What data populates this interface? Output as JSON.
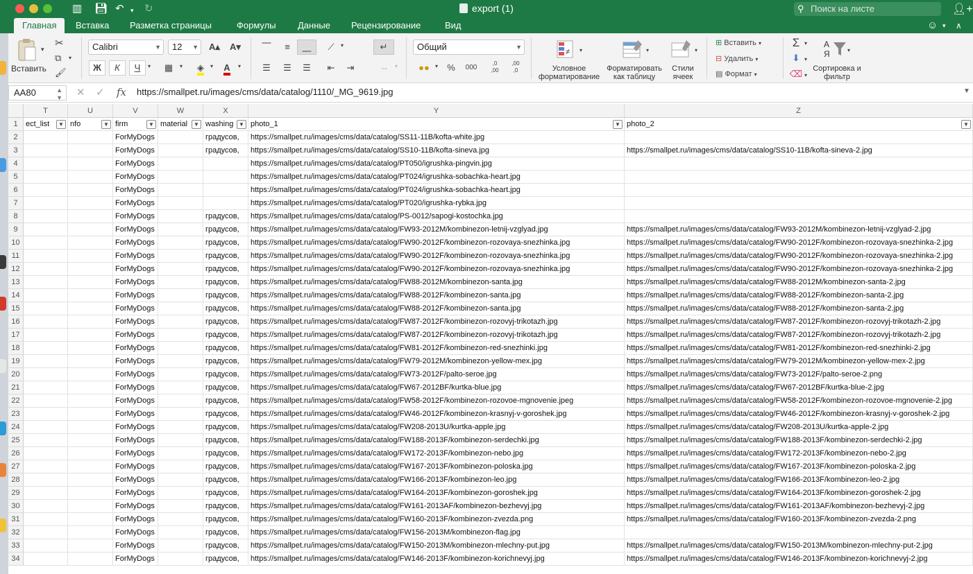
{
  "window": {
    "title": "export (1)",
    "search_placeholder": "Поиск на листе"
  },
  "ribbon_tabs": [
    {
      "label": "Главная",
      "active": true
    },
    {
      "label": "Вставка"
    },
    {
      "label": "Разметка страницы"
    },
    {
      "label": "Формулы"
    },
    {
      "label": "Данные"
    },
    {
      "label": "Рецензирование"
    },
    {
      "label": "Вид"
    }
  ],
  "ribbon": {
    "paste_label": "Вставить",
    "font_name": "Calibri",
    "font_size": "12",
    "bold_label": "Ж",
    "italic_label": "К",
    "underline_label": "Ч",
    "number_format": "Общий",
    "percent_label": "%",
    "thousands_label": "000",
    "conditional_label": "Условное форматирование",
    "format_table_label": "Форматировать как таблицу",
    "styles_label": "Стили ячеек",
    "insert_label": "Вставить",
    "delete_label": "Удалить",
    "format_label": "Формат",
    "sort_label": "Сортировка и фильтр",
    "inc_decimal": ",0\n,00",
    "dec_decimal": ",00\n,0"
  },
  "formula_bar": {
    "name_box": "AA80",
    "fx": "fx",
    "formula": "https://smallpet.ru/images/cms/data/catalog/1110/_MG_9619.jpg"
  },
  "columns": [
    {
      "letter": "T",
      "header": "ect_list"
    },
    {
      "letter": "U",
      "header": "nfo"
    },
    {
      "letter": "V",
      "header": "firm"
    },
    {
      "letter": "W",
      "header": "material"
    },
    {
      "letter": "X",
      "header": "washing"
    },
    {
      "letter": "Y",
      "header": "photo_1"
    },
    {
      "letter": "Z",
      "header": "photo_2"
    }
  ],
  "rows": [
    {
      "n": "2",
      "v": "ForMyDogs",
      "x": "градусов,",
      "y": "https://smallpet.ru/images/cms/data/catalog/SS11-11B/kofta-white.jpg",
      "z": ""
    },
    {
      "n": "3",
      "v": "ForMyDogs",
      "x": "градусов,",
      "y": "https://smallpet.ru/images/cms/data/catalog/SS10-11B/kofta-sineva.jpg",
      "z": "https://smallpet.ru/images/cms/data/catalog/SS10-11B/kofta-sineva-2.jpg"
    },
    {
      "n": "4",
      "v": "ForMyDogs",
      "x": "",
      "y": "https://smallpet.ru/images/cms/data/catalog/PT050/igrushka-pingvin.jpg",
      "z": ""
    },
    {
      "n": "5",
      "v": "ForMyDogs",
      "x": "",
      "y": "https://smallpet.ru/images/cms/data/catalog/PT024/igrushka-sobachka-heart.jpg",
      "z": ""
    },
    {
      "n": "6",
      "v": "ForMyDogs",
      "x": "",
      "y": "https://smallpet.ru/images/cms/data/catalog/PT024/igrushka-sobachka-heart.jpg",
      "z": ""
    },
    {
      "n": "7",
      "v": "ForMyDogs",
      "x": "",
      "y": "https://smallpet.ru/images/cms/data/catalog/PT020/igrushka-rybka.jpg",
      "z": ""
    },
    {
      "n": "8",
      "v": "ForMyDogs",
      "x": "градусов,",
      "y": "https://smallpet.ru/images/cms/data/catalog/PS-0012/sapogi-kostochka.jpg",
      "z": ""
    },
    {
      "n": "9",
      "v": "ForMyDogs",
      "x": "градусов,",
      "y": "https://smallpet.ru/images/cms/data/catalog/FW93-2012M/kombinezon-letnij-vzglyad.jpg",
      "z": "https://smallpet.ru/images/cms/data/catalog/FW93-2012M/kombinezon-letnij-vzglyad-2.jpg"
    },
    {
      "n": "10",
      "v": "ForMyDogs",
      "x": "градусов,",
      "y": "https://smallpet.ru/images/cms/data/catalog/FW90-2012F/kombinezon-rozovaya-snezhinka.jpg",
      "z": "https://smallpet.ru/images/cms/data/catalog/FW90-2012F/kombinezon-rozovaya-snezhinka-2.jpg"
    },
    {
      "n": "11",
      "v": "ForMyDogs",
      "x": "градусов,",
      "y": "https://smallpet.ru/images/cms/data/catalog/FW90-2012F/kombinezon-rozovaya-snezhinka.jpg",
      "z": "https://smallpet.ru/images/cms/data/catalog/FW90-2012F/kombinezon-rozovaya-snezhinka-2.jpg"
    },
    {
      "n": "12",
      "v": "ForMyDogs",
      "x": "градусов,",
      "y": "https://smallpet.ru/images/cms/data/catalog/FW90-2012F/kombinezon-rozovaya-snezhinka.jpg",
      "z": "https://smallpet.ru/images/cms/data/catalog/FW90-2012F/kombinezon-rozovaya-snezhinka-2.jpg"
    },
    {
      "n": "13",
      "v": "ForMyDogs",
      "x": "градусов,",
      "y": "https://smallpet.ru/images/cms/data/catalog/FW88-2012M/kombinezon-santa.jpg",
      "z": "https://smallpet.ru/images/cms/data/catalog/FW88-2012M/kombinezon-santa-2.jpg"
    },
    {
      "n": "14",
      "v": "ForMyDogs",
      "x": "градусов,",
      "y": "https://smallpet.ru/images/cms/data/catalog/FW88-2012F/kombinezon-santa.jpg",
      "z": "https://smallpet.ru/images/cms/data/catalog/FW88-2012F/kombinezon-santa-2.jpg"
    },
    {
      "n": "15",
      "v": "ForMyDogs",
      "x": "градусов,",
      "y": "https://smallpet.ru/images/cms/data/catalog/FW88-2012F/kombinezon-santa.jpg",
      "z": "https://smallpet.ru/images/cms/data/catalog/FW88-2012F/kombinezon-santa-2.jpg"
    },
    {
      "n": "16",
      "v": "ForMyDogs",
      "x": "градусов,",
      "y": "https://smallpet.ru/images/cms/data/catalog/FW87-2012F/kombinezon-rozovyj-trikotazh.jpg",
      "z": "https://smallpet.ru/images/cms/data/catalog/FW87-2012F/kombinezon-rozovyj-trikotazh-2.jpg"
    },
    {
      "n": "17",
      "v": "ForMyDogs",
      "x": "градусов,",
      "y": "https://smallpet.ru/images/cms/data/catalog/FW87-2012F/kombinezon-rozovyj-trikotazh.jpg",
      "z": "https://smallpet.ru/images/cms/data/catalog/FW87-2012F/kombinezon-rozovyj-trikotazh-2.jpg"
    },
    {
      "n": "18",
      "v": "ForMyDogs",
      "x": "градусов,",
      "y": "https://smallpet.ru/images/cms/data/catalog/FW81-2012F/kombinezon-red-snezhinki.jpg",
      "z": "https://smallpet.ru/images/cms/data/catalog/FW81-2012F/kombinezon-red-snezhinki-2.jpg"
    },
    {
      "n": "19",
      "v": "ForMyDogs",
      "x": "градусов,",
      "y": "https://smallpet.ru/images/cms/data/catalog/FW79-2012M/kombinezon-yellow-mex.jpg",
      "z": "https://smallpet.ru/images/cms/data/catalog/FW79-2012M/kombinezon-yellow-mex-2.jpg"
    },
    {
      "n": "20",
      "v": "ForMyDogs",
      "x": "градусов,",
      "y": "https://smallpet.ru/images/cms/data/catalog/FW73-2012F/palto-seroe.jpg",
      "z": "https://smallpet.ru/images/cms/data/catalog/FW73-2012F/palto-seroe-2.png"
    },
    {
      "n": "21",
      "v": "ForMyDogs",
      "x": "градусов,",
      "y": "https://smallpet.ru/images/cms/data/catalog/FW67-2012BF/kurtka-blue.jpg",
      "z": "https://smallpet.ru/images/cms/data/catalog/FW67-2012BF/kurtka-blue-2.jpg"
    },
    {
      "n": "22",
      "v": "ForMyDogs",
      "x": "градусов,",
      "y": "https://smallpet.ru/images/cms/data/catalog/FW58-2012F/kombinezon-rozovoe-mgnovenie.jpeg",
      "z": "https://smallpet.ru/images/cms/data/catalog/FW58-2012F/kombinezon-rozovoe-mgnovenie-2.jpg"
    },
    {
      "n": "23",
      "v": "ForMyDogs",
      "x": "градусов,",
      "y": "https://smallpet.ru/images/cms/data/catalog/FW46-2012F/kombinezon-krasnyj-v-goroshek.jpg",
      "z": "https://smallpet.ru/images/cms/data/catalog/FW46-2012F/kombinezon-krasnyj-v-goroshek-2.jpg"
    },
    {
      "n": "24",
      "v": "ForMyDogs",
      "x": "градусов,",
      "y": "https://smallpet.ru/images/cms/data/catalog/FW208-2013U/kurtka-apple.jpg",
      "z": "https://smallpet.ru/images/cms/data/catalog/FW208-2013U/kurtka-apple-2.jpg"
    },
    {
      "n": "25",
      "v": "ForMyDogs",
      "x": "градусов,",
      "y": "https://smallpet.ru/images/cms/data/catalog/FW188-2013F/kombinezon-serdechki.jpg",
      "z": "https://smallpet.ru/images/cms/data/catalog/FW188-2013F/kombinezon-serdechki-2.jpg"
    },
    {
      "n": "26",
      "v": "ForMyDogs",
      "x": "градусов,",
      "y": "https://smallpet.ru/images/cms/data/catalog/FW172-2013F/kombinezon-nebo.jpg",
      "z": "https://smallpet.ru/images/cms/data/catalog/FW172-2013F/kombinezon-nebo-2.jpg"
    },
    {
      "n": "27",
      "v": "ForMyDogs",
      "x": "градусов,",
      "y": "https://smallpet.ru/images/cms/data/catalog/FW167-2013F/kombinezon-poloska.jpg",
      "z": "https://smallpet.ru/images/cms/data/catalog/FW167-2013F/kombinezon-poloska-2.jpg"
    },
    {
      "n": "28",
      "v": "ForMyDogs",
      "x": "градусов,",
      "y": "https://smallpet.ru/images/cms/data/catalog/FW166-2013F/kombinezon-leo.jpg",
      "z": "https://smallpet.ru/images/cms/data/catalog/FW166-2013F/kombinezon-leo-2.jpg"
    },
    {
      "n": "29",
      "v": "ForMyDogs",
      "x": "градусов,",
      "y": "https://smallpet.ru/images/cms/data/catalog/FW164-2013F/kombinezon-goroshek.jpg",
      "z": "https://smallpet.ru/images/cms/data/catalog/FW164-2013F/kombinezon-goroshek-2.jpg"
    },
    {
      "n": "30",
      "v": "ForMyDogs",
      "x": "градусов,",
      "y": "https://smallpet.ru/images/cms/data/catalog/FW161-2013AF/kombinezon-bezhevyj.jpg",
      "z": "https://smallpet.ru/images/cms/data/catalog/FW161-2013AF/kombinezon-bezhevyj-2.jpg"
    },
    {
      "n": "31",
      "v": "ForMyDogs",
      "x": "градусов,",
      "y": "https://smallpet.ru/images/cms/data/catalog/FW160-2013F/kombinezon-zvezda.png",
      "z": "https://smallpet.ru/images/cms/data/catalog/FW160-2013F/kombinezon-zvezda-2.png"
    },
    {
      "n": "32",
      "v": "ForMyDogs",
      "x": "градусов,",
      "y": "https://smallpet.ru/images/cms/data/catalog/FW156-2013M/kombinezon-flag.jpg",
      "z": ""
    },
    {
      "n": "33",
      "v": "ForMyDogs",
      "x": "градусов,",
      "y": "https://smallpet.ru/images/cms/data/catalog/FW150-2013M/kombinezon-mlechny-put.jpg",
      "z": "https://smallpet.ru/images/cms/data/catalog/FW150-2013M/kombinezon-mlechny-put-2.jpg"
    },
    {
      "n": "34",
      "v": "ForMyDogs",
      "x": "градусов,",
      "y": "https://smallpet.ru/images/cms/data/catalog/FW146-2013F/kombinezon-korichnevyj.jpg",
      "z": "https://smallpet.ru/images/cms/data/catalog/FW146-2013F/kombinezon-korichnevyj-2.jpg"
    }
  ],
  "colors": {
    "accent": "#1d7a44",
    "ribbon_bg": "#f3f3f3",
    "grid_line": "#e2e2e2"
  }
}
